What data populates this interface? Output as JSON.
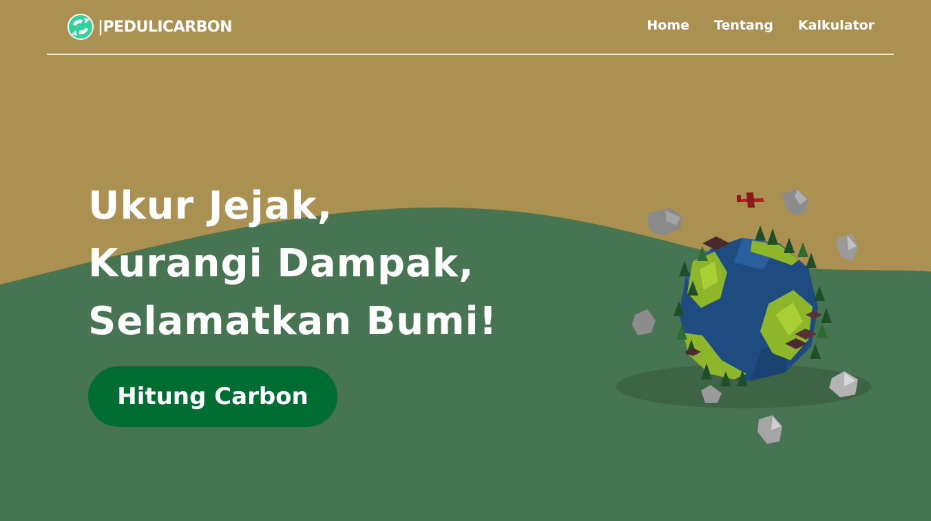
{
  "colors": {
    "sky": "#aa9152",
    "hill": "#477451",
    "button": "#006d33",
    "text": "#ffffff",
    "logo_accent": "#2fd39a"
  },
  "brand": {
    "logo_icon": "recycle-earth-icon",
    "name": "|PEDULICARBON"
  },
  "nav": {
    "items": [
      {
        "label": "Home"
      },
      {
        "label": "Tentang"
      },
      {
        "label": "Kalkulator"
      }
    ]
  },
  "hero": {
    "headline": [
      "Ukur Jejak,",
      "Kurangi Dampak,",
      "Selamatkan Bumi!"
    ],
    "cta_label": "Hitung Carbon",
    "illustration": "low-poly-earth-illustration"
  }
}
